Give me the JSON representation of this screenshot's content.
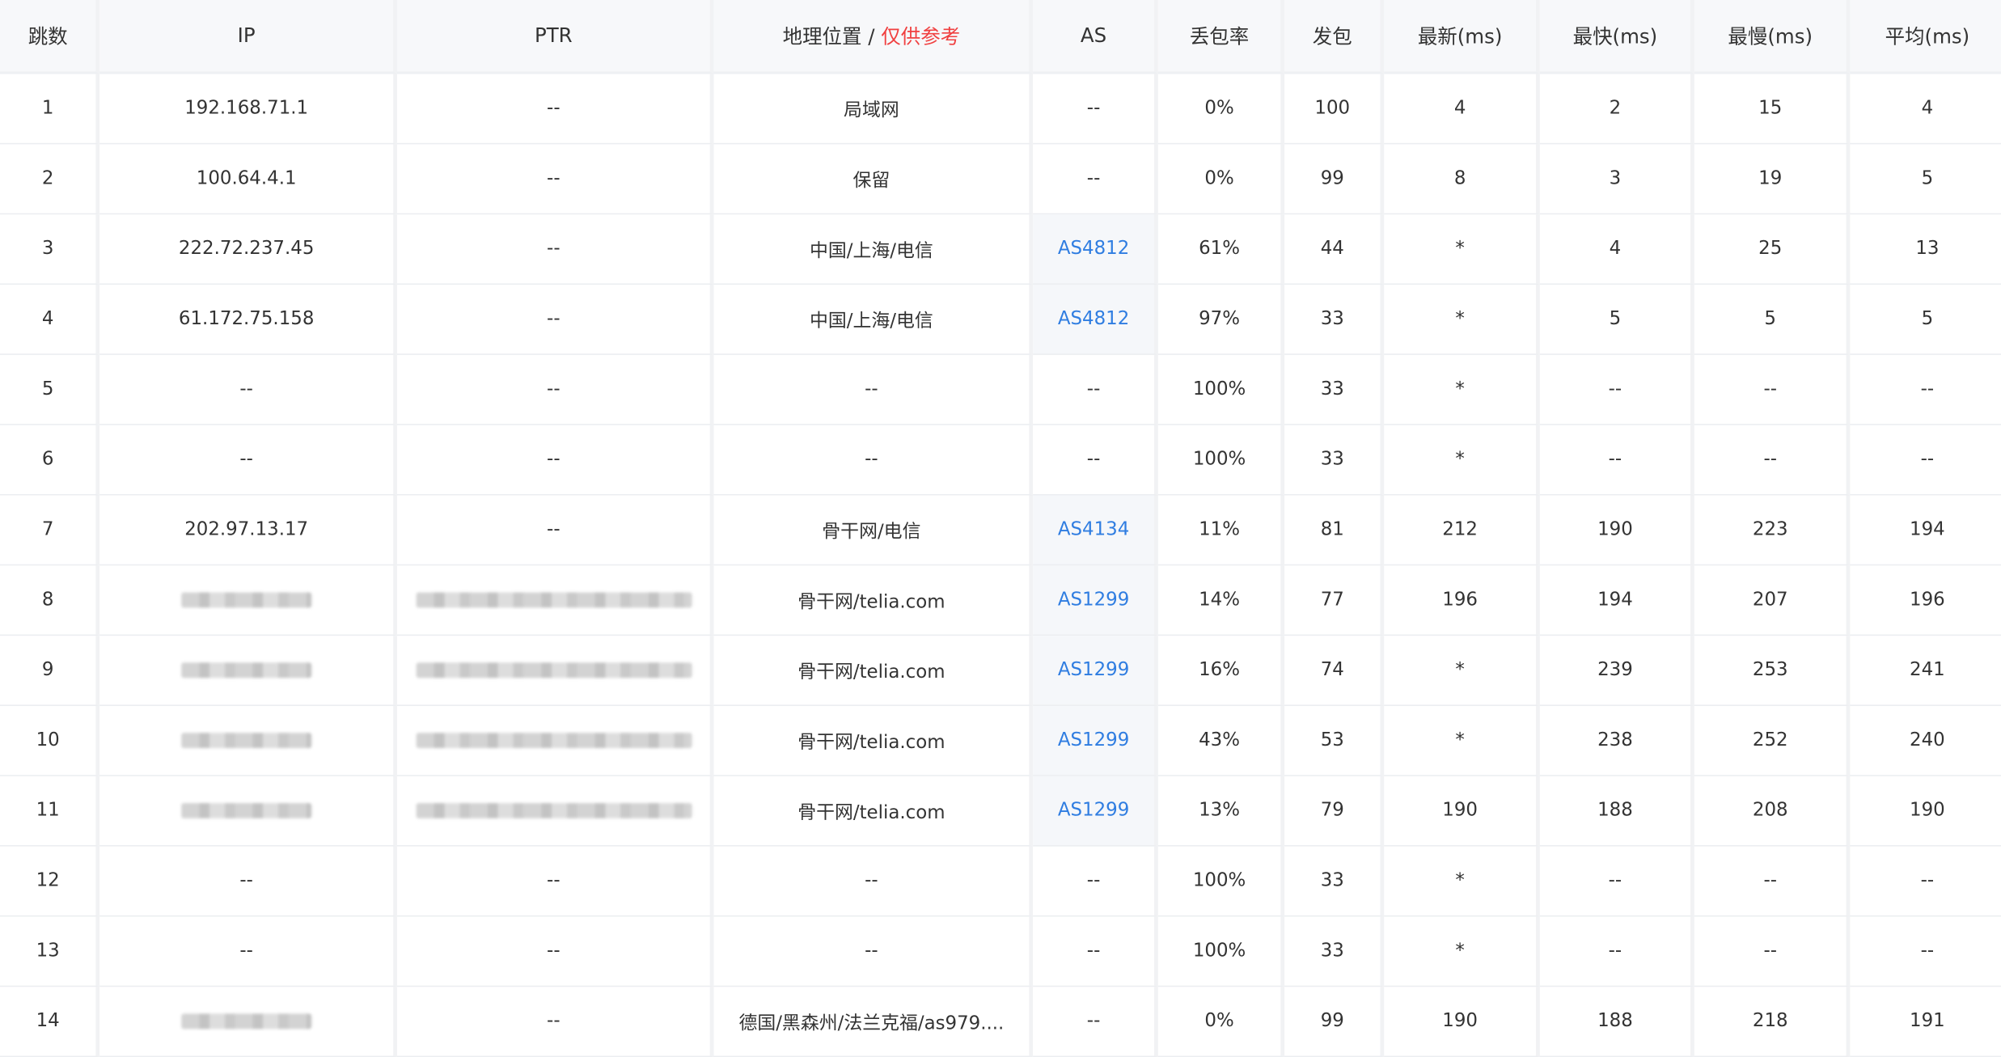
{
  "columns": {
    "hop": "跳数",
    "ip": "IP",
    "ptr": "PTR",
    "geo": "地理位置 / ",
    "geo_note": "仅供参考",
    "as": "AS",
    "loss": "丢包率",
    "sent": "发包",
    "last": "最新(ms)",
    "best": "最快(ms)",
    "worst": "最慢(ms)",
    "avg": "平均(ms)"
  },
  "rows": [
    {
      "hop": "1",
      "ip": "192.168.71.1",
      "ip_blurred": false,
      "ptr": "--",
      "ptr_blurred": false,
      "geo": "局域网",
      "as": "--",
      "loss": "0%",
      "sent": "100",
      "last": "4",
      "best": "2",
      "worst": "15",
      "avg": "4"
    },
    {
      "hop": "2",
      "ip": "100.64.4.1",
      "ip_blurred": false,
      "ptr": "--",
      "ptr_blurred": false,
      "geo": "保留",
      "as": "--",
      "loss": "0%",
      "sent": "99",
      "last": "8",
      "best": "3",
      "worst": "19",
      "avg": "5"
    },
    {
      "hop": "3",
      "ip": "222.72.237.45",
      "ip_blurred": false,
      "ptr": "--",
      "ptr_blurred": false,
      "geo": "中国/上海/电信",
      "as": "AS4812",
      "loss": "61%",
      "sent": "44",
      "last": "*",
      "best": "4",
      "worst": "25",
      "avg": "13"
    },
    {
      "hop": "4",
      "ip": "61.172.75.158",
      "ip_blurred": false,
      "ptr": "--",
      "ptr_blurred": false,
      "geo": "中国/上海/电信",
      "as": "AS4812",
      "loss": "97%",
      "sent": "33",
      "last": "*",
      "best": "5",
      "worst": "5",
      "avg": "5"
    },
    {
      "hop": "5",
      "ip": "--",
      "ip_blurred": false,
      "ptr": "--",
      "ptr_blurred": false,
      "geo": "--",
      "as": "--",
      "loss": "100%",
      "sent": "33",
      "last": "*",
      "best": "--",
      "worst": "--",
      "avg": "--"
    },
    {
      "hop": "6",
      "ip": "--",
      "ip_blurred": false,
      "ptr": "--",
      "ptr_blurred": false,
      "geo": "--",
      "as": "--",
      "loss": "100%",
      "sent": "33",
      "last": "*",
      "best": "--",
      "worst": "--",
      "avg": "--"
    },
    {
      "hop": "7",
      "ip": "202.97.13.17",
      "ip_blurred": false,
      "ptr": "--",
      "ptr_blurred": false,
      "geo": "骨干网/电信",
      "as": "AS4134",
      "loss": "11%",
      "sent": "81",
      "last": "212",
      "best": "190",
      "worst": "223",
      "avg": "194"
    },
    {
      "hop": "8",
      "ip": "",
      "ip_blurred": true,
      "ptr": "",
      "ptr_blurred": true,
      "geo": "骨干网/telia.com",
      "as": "AS1299",
      "loss": "14%",
      "sent": "77",
      "last": "196",
      "best": "194",
      "worst": "207",
      "avg": "196"
    },
    {
      "hop": "9",
      "ip": "",
      "ip_blurred": true,
      "ptr": "",
      "ptr_blurred": true,
      "geo": "骨干网/telia.com",
      "as": "AS1299",
      "loss": "16%",
      "sent": "74",
      "last": "*",
      "best": "239",
      "worst": "253",
      "avg": "241"
    },
    {
      "hop": "10",
      "ip": "",
      "ip_blurred": true,
      "ptr": "",
      "ptr_blurred": true,
      "geo": "骨干网/telia.com",
      "as": "AS1299",
      "loss": "43%",
      "sent": "53",
      "last": "*",
      "best": "238",
      "worst": "252",
      "avg": "240"
    },
    {
      "hop": "11",
      "ip": "",
      "ip_blurred": true,
      "ptr": "",
      "ptr_blurred": true,
      "geo": "骨干网/telia.com",
      "as": "AS1299",
      "loss": "13%",
      "sent": "79",
      "last": "190",
      "best": "188",
      "worst": "208",
      "avg": "190"
    },
    {
      "hop": "12",
      "ip": "--",
      "ip_blurred": false,
      "ptr": "--",
      "ptr_blurred": false,
      "geo": "--",
      "as": "--",
      "loss": "100%",
      "sent": "33",
      "last": "*",
      "best": "--",
      "worst": "--",
      "avg": "--"
    },
    {
      "hop": "13",
      "ip": "--",
      "ip_blurred": false,
      "ptr": "--",
      "ptr_blurred": false,
      "geo": "--",
      "as": "--",
      "loss": "100%",
      "sent": "33",
      "last": "*",
      "best": "--",
      "worst": "--",
      "avg": "--"
    },
    {
      "hop": "14",
      "ip": "",
      "ip_blurred": true,
      "ptr": "--",
      "ptr_blurred": false,
      "geo": "德国/黑森州/法兰克福/as979....",
      "as": "--",
      "loss": "0%",
      "sent": "99",
      "last": "190",
      "best": "188",
      "worst": "218",
      "avg": "191"
    }
  ],
  "colors": {
    "link": "#2f7de1",
    "warn": "#f04040",
    "header_bg": "#f7f8fa"
  }
}
